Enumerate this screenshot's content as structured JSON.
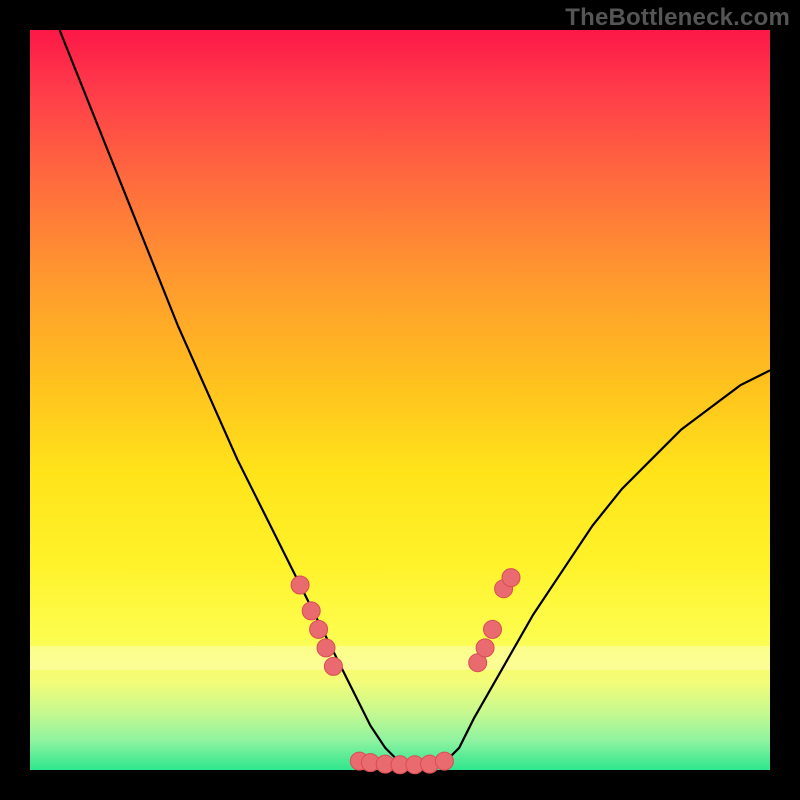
{
  "watermark": "TheBottleneck.com",
  "colors": {
    "frame": "#000000",
    "curve": "#000000",
    "marker_fill": "#e96a6f",
    "marker_stroke": "#d94d55",
    "gradient_top": "#fc1847",
    "gradient_bottom": "#2ee68e"
  },
  "chart_data": {
    "type": "line",
    "title": "",
    "xlabel": "",
    "ylabel": "",
    "xlim": [
      0,
      100
    ],
    "ylim": [
      0,
      100
    ],
    "grid": false,
    "legend": false,
    "series": [
      {
        "name": "curve",
        "x": [
          4,
          8,
          12,
          16,
          20,
          24,
          28,
          32,
          36,
          40,
          42,
          44,
          46,
          48,
          50,
          52,
          54,
          56,
          58,
          60,
          64,
          68,
          72,
          76,
          80,
          84,
          88,
          92,
          96,
          100
        ],
        "y": [
          100,
          90,
          80,
          70,
          60,
          51,
          42,
          34,
          26,
          18,
          14,
          10,
          6,
          3,
          1,
          0.5,
          0.5,
          1,
          3,
          7,
          14,
          21,
          27,
          33,
          38,
          42,
          46,
          49,
          52,
          54
        ]
      }
    ],
    "markers": [
      {
        "x": 36.5,
        "y": 25
      },
      {
        "x": 38,
        "y": 21.5
      },
      {
        "x": 39,
        "y": 19
      },
      {
        "x": 40,
        "y": 16.5
      },
      {
        "x": 41,
        "y": 14
      },
      {
        "x": 44.5,
        "y": 1.2
      },
      {
        "x": 46,
        "y": 1.0
      },
      {
        "x": 48,
        "y": 0.8
      },
      {
        "x": 50,
        "y": 0.7
      },
      {
        "x": 52,
        "y": 0.7
      },
      {
        "x": 54,
        "y": 0.8
      },
      {
        "x": 56,
        "y": 1.2
      },
      {
        "x": 60.5,
        "y": 14.5
      },
      {
        "x": 61.5,
        "y": 16.5
      },
      {
        "x": 62.5,
        "y": 19
      },
      {
        "x": 64,
        "y": 24.5
      },
      {
        "x": 65,
        "y": 26
      }
    ]
  }
}
